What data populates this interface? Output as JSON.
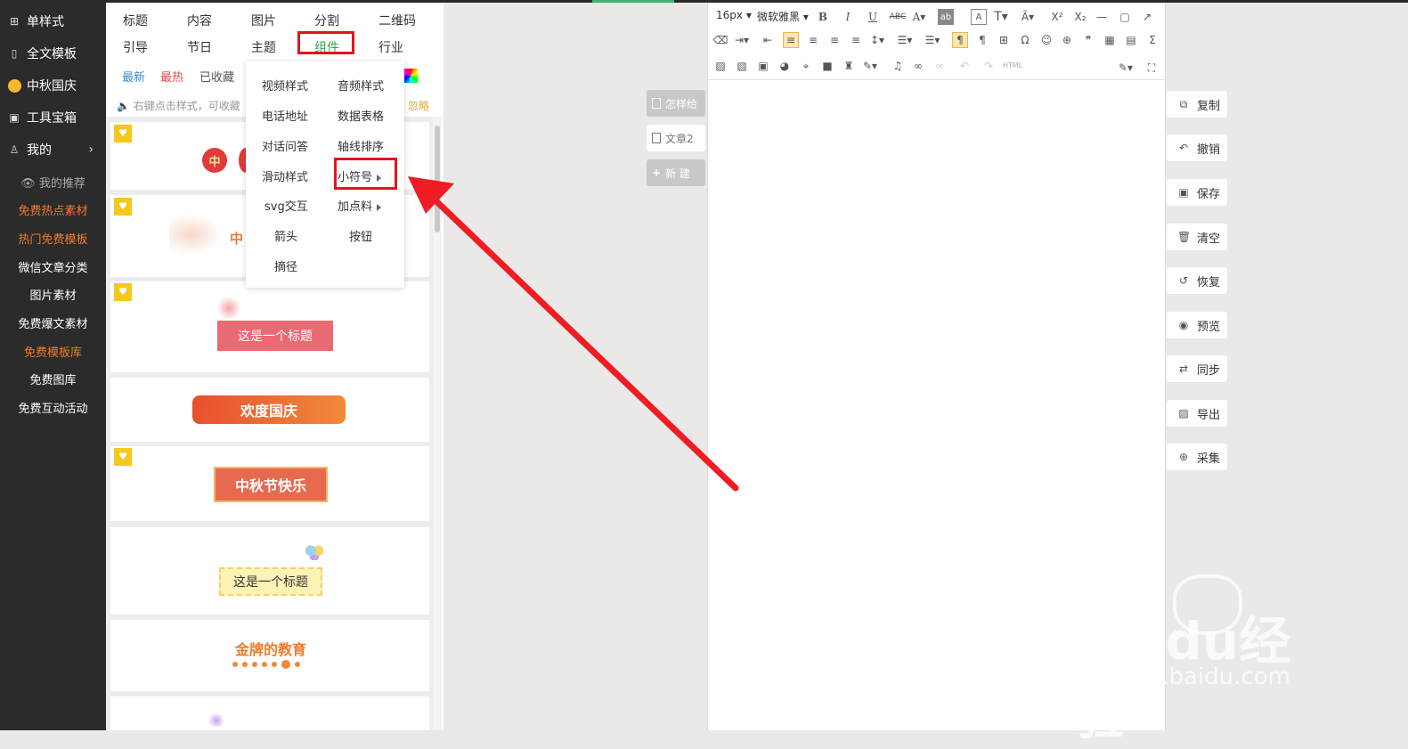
{
  "sidebar": {
    "nav": [
      {
        "label": "单样式",
        "icon": "grid-icon"
      },
      {
        "label": "全文模板",
        "icon": "layout-icon"
      },
      {
        "label": "中秋国庆",
        "icon": "moon-icon"
      },
      {
        "label": "工具宝箱",
        "icon": "toolbox-icon"
      },
      {
        "label": "我的",
        "icon": "user-icon"
      }
    ],
    "my_recommend": "我的推荐",
    "links": [
      "免费热点素材",
      "热门免费模板",
      "微信文章分类",
      "图片素材",
      "免费爆文素材",
      "免费模板库",
      "免费图库",
      "免费互动活动"
    ]
  },
  "panel": {
    "tabs_row1": [
      "标题",
      "内容",
      "图片",
      "分割",
      "二维码"
    ],
    "tabs_row2": [
      "引导",
      "节日",
      "主题",
      "组件",
      "行业"
    ],
    "sort": [
      "最新",
      "最热",
      "已收藏"
    ],
    "tip": "右键点击样式，可收藏",
    "ignore": "忽略"
  },
  "samples": {
    "lantern_char": "中",
    "mid_autumn_partial": "中",
    "title1": "这是一个标题",
    "national_day": "欢度国庆",
    "mid_autumn": "中秋节快乐",
    "title2": "这是一个标题",
    "gold_edu": "金牌的教育"
  },
  "dropdown": {
    "items": [
      "视频样式",
      "音频样式",
      "电话地址",
      "数据表格",
      "对话问答",
      "轴线排序",
      "滑动样式",
      "小符号",
      "svg交互",
      "加点料",
      "箭头",
      "按钮",
      "摘径"
    ]
  },
  "articles": {
    "item1": "怎样给",
    "item2": "文章2",
    "new": "新 建"
  },
  "editor": {
    "font_size": "16px",
    "font_family": "微软雅黑",
    "html_label": "HTML"
  },
  "right_actions": [
    {
      "label": "复制",
      "icon": "copy-icon"
    },
    {
      "label": "撤销",
      "icon": "undo-icon"
    },
    {
      "label": "保存",
      "icon": "save-icon"
    },
    {
      "label": "清空",
      "icon": "trash-icon"
    },
    {
      "label": "恢复",
      "icon": "restore-icon"
    },
    {
      "label": "预览",
      "icon": "eye-icon"
    },
    {
      "label": "同步",
      "icon": "sync-icon"
    },
    {
      "label": "导出",
      "icon": "export-icon"
    },
    {
      "label": "采集",
      "icon": "zoom-icon"
    }
  ],
  "watermark": {
    "brand": "Baidu经验",
    "url": "jingyan.baidu.com"
  },
  "colors": {
    "accent_green": "#3aa14b",
    "highlight_red": "#e0151e",
    "sidebar_bg": "#2b2b2b",
    "orange": "#f07b2d"
  }
}
